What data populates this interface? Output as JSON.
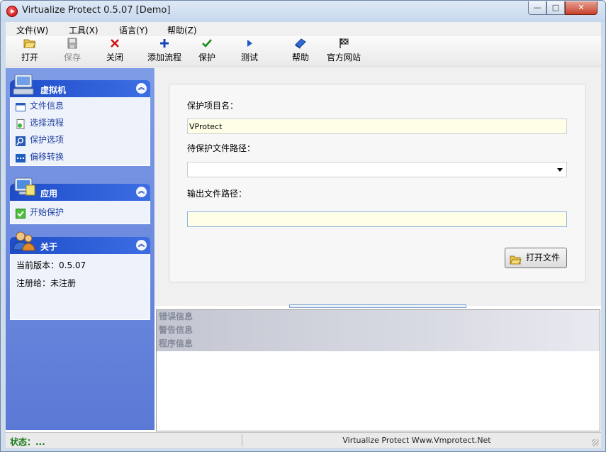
{
  "window": {
    "title": "Virtualize Protect 0.5.07 [Demo]",
    "minimize_label": "—",
    "maximize_label": "□",
    "close_label": "✕"
  },
  "menu": [
    {
      "label": "文件(W)"
    },
    {
      "label": "工具(X)"
    },
    {
      "label": "语言(Y)"
    },
    {
      "label": "帮助(Z)"
    }
  ],
  "toolbar": {
    "open": {
      "label": "打开",
      "icon": "folder-open-icon"
    },
    "save": {
      "label": "保存",
      "icon": "floppy-disk-icon"
    },
    "close": {
      "label": "关闭",
      "icon": "red-x-icon"
    },
    "add_flow": {
      "label": "添加流程",
      "icon": "plus-icon"
    },
    "protect": {
      "label": "保护",
      "icon": "checkmark-icon"
    },
    "test": {
      "label": "测试",
      "icon": "play-icon"
    },
    "help": {
      "label": "帮助",
      "icon": "help-book-icon"
    },
    "website": {
      "label": "官方网站",
      "icon": "checkered-flag-icon"
    }
  },
  "sidebar": {
    "vm_group": {
      "title": "虚拟机",
      "items": [
        {
          "label": "文件信息",
          "icon": "window-icon"
        },
        {
          "label": "选择流程",
          "icon": "document-icon"
        },
        {
          "label": "保护选项",
          "icon": "magnifier-icon"
        },
        {
          "label": "偏移转换",
          "icon": "dots-icon"
        }
      ]
    },
    "app_group": {
      "title": "应用",
      "items": [
        {
          "label": "开始保护",
          "icon": "green-check-icon"
        }
      ]
    },
    "about_group": {
      "title": "关于",
      "lines": [
        {
          "text": "当前版本：0.5.07"
        },
        {
          "text": "注册给：未注册"
        }
      ]
    }
  },
  "form": {
    "project_name_label": "保护项目名：",
    "project_name_value": "VProtect",
    "file_path_label": "待保护文件路径：",
    "file_path_value": "",
    "output_path_label": "输出文件路径：",
    "output_path_value": "",
    "open_file_button": "打开文件"
  },
  "log": {
    "rows": [
      {
        "label": "错误信息"
      },
      {
        "label": "警告信息"
      },
      {
        "label": "程序信息"
      }
    ]
  },
  "statusbar": {
    "status_text": "状态：...",
    "center_text": "Virtualize Protect Www.Vmprotect.Net"
  },
  "colors": {
    "sidebar_header": "#1e4cc9",
    "sidebar_bg": "#6a88de",
    "input_bg": "#ffffe8",
    "status_green": "#1a7a1a"
  }
}
